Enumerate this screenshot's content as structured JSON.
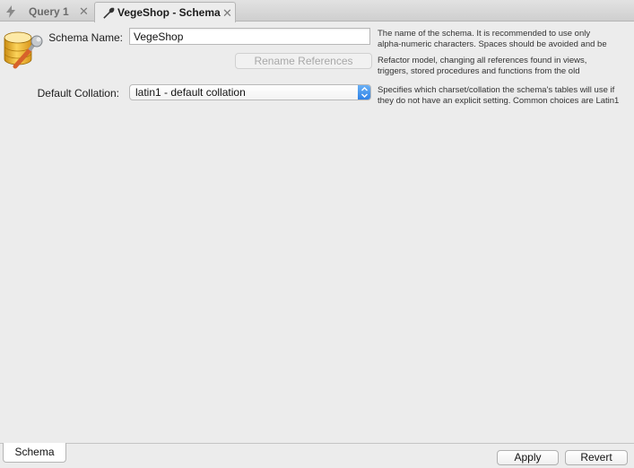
{
  "tabs": [
    {
      "label": "Query 1",
      "icon": "bolt-icon",
      "active": false
    },
    {
      "label": "VegeShop - Schema",
      "icon": "wrench-icon",
      "active": true
    }
  ],
  "form": {
    "schema_name_label": "Schema Name:",
    "schema_name_value": "VegeShop",
    "rename_button": "Rename References",
    "collation_label": "Default Collation:",
    "collation_value": "latin1 - default collation"
  },
  "help": {
    "name_line1": "The name of the schema. It is recommended to use only",
    "name_line2": "alpha-numeric characters. Spaces should be avoided and be",
    "rename_line1": "Refactor model, changing all references found in views,",
    "rename_line2": "triggers, stored procedures and functions from the old",
    "collation_line1": "Specifies which charset/collation the schema's tables will use if",
    "collation_line2": "they do not have an explicit setting. Common choices are Latin1"
  },
  "bottom": {
    "tab_label": "Schema",
    "apply_label": "Apply",
    "revert_label": "Revert"
  },
  "colors": {
    "accent": "#2b7fe6",
    "background": "#ececec",
    "schema_icon": "#f2b632"
  }
}
